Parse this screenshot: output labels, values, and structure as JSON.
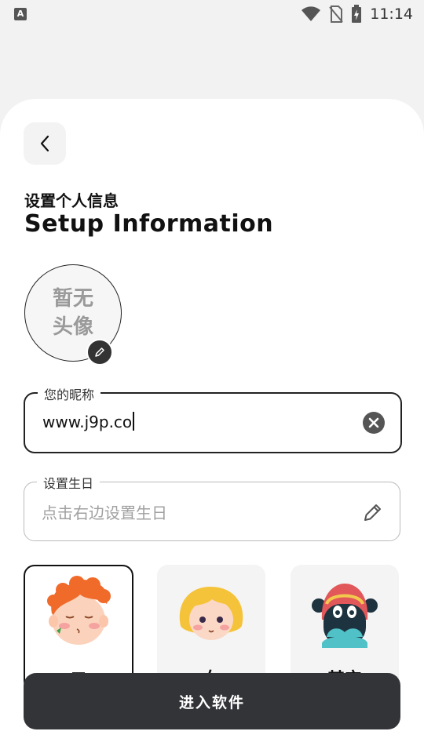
{
  "status_bar": {
    "time": "11:14",
    "app_badge": "A"
  },
  "header": {
    "title_cn": "设置个人信息",
    "title_en": "Setup Information"
  },
  "avatar": {
    "placeholder_line1": "暂无",
    "placeholder_line2": "头像"
  },
  "nickname": {
    "label": "您的昵称",
    "value": "www.j9p.co"
  },
  "birthday": {
    "label": "设置生日",
    "placeholder": "点击右边设置生日"
  },
  "gender": {
    "options": [
      {
        "label": "男",
        "selected": true
      },
      {
        "label": "女",
        "selected": false
      },
      {
        "label": "其它",
        "selected": false
      }
    ]
  },
  "enter_button": {
    "label": "进入软件"
  },
  "colors": {
    "button_bg": "#333438",
    "page_bg": "#f2f2f2",
    "card_bg": "#ffffff"
  }
}
